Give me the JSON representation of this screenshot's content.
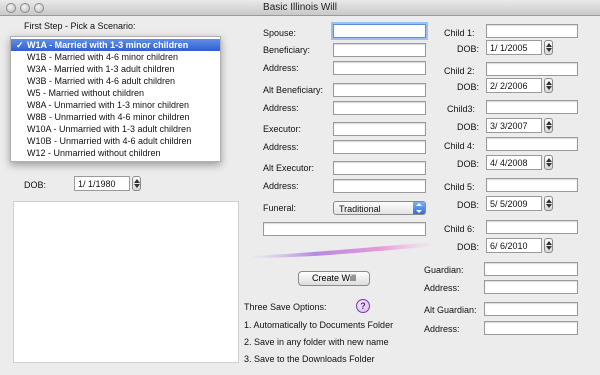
{
  "window": {
    "title": "Basic Illinois Will"
  },
  "scenario": {
    "heading": "First Step - Pick a Scenario:",
    "options": [
      "W1A - Married with 1-3 minor children",
      "W1B - Married with 4-6 minor children",
      "W3A - Married with 1-3 adult children",
      "W3B - Married with 4-6 adult children",
      "W5 - Married without children",
      "W8A - Unmarried with 1-3 minor children",
      "W8B - Unmarried with 4-6 minor children",
      "W10A - Unmarried with 1-3 adult children",
      "W10B - Unmarried with 4-6 adult children",
      "W12 - Unmarried without children"
    ],
    "selected_index": 0,
    "check": "✓"
  },
  "testator": {
    "dob_label": "DOB:",
    "dob_value": "1/  1/1980"
  },
  "middle": {
    "spouse_label": "Spouse:",
    "beneficiary_label": "Beneficiary:",
    "address_label": "Address:",
    "alt_beneficiary_label": "Alt Beneficiary:",
    "executor_label": "Executor:",
    "alt_executor_label": "Alt Executor:",
    "funeral_label": "Funeral:",
    "funeral_value": "Traditional"
  },
  "create_button": "Create Will",
  "save": {
    "heading": "Three Save Options:",
    "help_glyph": "?",
    "option1": "1. Automatically to Documents Folder",
    "option2": "2. Save in any folder with new name",
    "option3": "3. Save to the Downloads Folder"
  },
  "children": {
    "dob_label": "DOB:",
    "items": [
      {
        "label": "Child 1:",
        "dob": "1/  1/2005"
      },
      {
        "label": "Child 2:",
        "dob": "2/  2/2006"
      },
      {
        "label": "Child3:",
        "dob": "3/  3/2007"
      },
      {
        "label": "Child 4:",
        "dob": "4/  4/2008"
      },
      {
        "label": "Child 5:",
        "dob": "5/  5/2009"
      },
      {
        "label": "Child 6:",
        "dob": "6/  6/2010"
      }
    ]
  },
  "guardian": {
    "label": "Guardian:",
    "address_label": "Address:"
  },
  "alt_guardian": {
    "label": "Alt Guardian:",
    "address_label": "Address:"
  },
  "colors": {
    "selection": "#2f5fd0",
    "focus": "#9cc0f0",
    "help": "#7a3aa8"
  }
}
